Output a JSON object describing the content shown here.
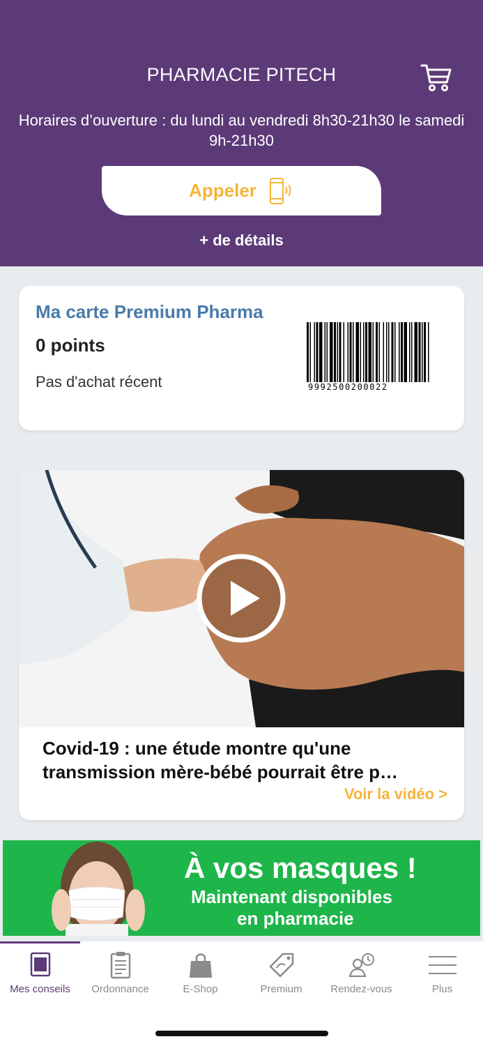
{
  "header": {
    "title": "PHARMACIE PITECH",
    "hours": "Horaires d’ouverture : du lundi au vendredi 8h30-21h30 le samedi 9h-21h30",
    "call_label": "Appeler",
    "details_label": "+ de détails",
    "cart_icon": "cart-icon",
    "phone_icon": "phone-ringing-icon"
  },
  "premium_card": {
    "title": "Ma carte Premium Pharma",
    "points": "0 points",
    "status": "Pas d'achat récent",
    "barcode_number": "9992500200022"
  },
  "video_card": {
    "title": "Covid-19 : une étude montre qu'une transmission mère-bébé pourrait être p…",
    "link_label": "Voir la vidéo >",
    "play_icon": "play-icon"
  },
  "banner": {
    "title": "À vos masques !",
    "line1": "Maintenant disponibles",
    "line2": "en pharmacie"
  },
  "tabbar": {
    "items": [
      {
        "label": "Mes conseils",
        "icon": "book-icon",
        "active": true
      },
      {
        "label": "Ordonnance",
        "icon": "clipboard-icon",
        "active": false
      },
      {
        "label": "E-Shop",
        "icon": "shopping-bag-icon",
        "active": false
      },
      {
        "label": "Premium",
        "icon": "tag-icon",
        "active": false
      },
      {
        "label": "Rendez-vous",
        "icon": "appointment-icon",
        "active": false
      },
      {
        "label": "Plus",
        "icon": "menu-icon",
        "active": false
      }
    ]
  },
  "colors": {
    "header_bg": "#5c3a78",
    "accent_yellow": "#f4b43a",
    "premium_title": "#4a7aab",
    "banner_green": "#1eb54a",
    "tab_inactive": "#8a8a8a"
  }
}
